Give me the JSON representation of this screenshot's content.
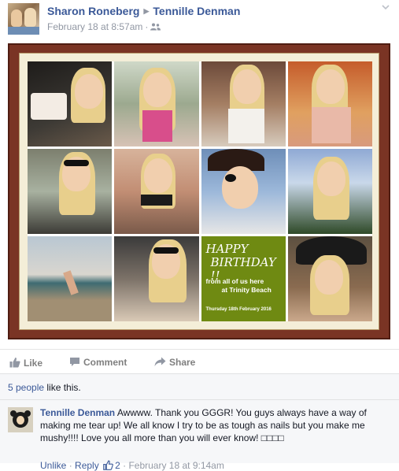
{
  "post": {
    "author": "Sharon Roneberg",
    "target": "Tennille Denman",
    "timestamp": "February 18 at 8:57am",
    "privacy_icon": "friends-icon",
    "menu_icon": "chevron-down-icon"
  },
  "photo": {
    "banner_line1": "HAPPY",
    "banner_line2": "BIRTHDAY !!",
    "banner_sub_line1": "from all of us here",
    "banner_sub_line2": "at Trinity Beach",
    "banner_date": "Thursday 18th February 2016",
    "colors": {
      "frame": "#7a3424",
      "mat": "#f4eed8",
      "banner": "#6f8a12"
    }
  },
  "actions": {
    "like": "Like",
    "comment": "Comment",
    "share": "Share"
  },
  "likes": {
    "count_link": "5 people",
    "suffix": " like this."
  },
  "comment": {
    "author": "Tennille Denman",
    "text": "Awwww. Thank you GGGR! You guys always have a way of making me tear up! We all know I try to be as tough as nails but you make me mushy!!!! Love you all more than you will ever know! □□□□",
    "unlike": "Unlike",
    "reply": "Reply",
    "like_count": "2",
    "timestamp": "February 18 at 9:14am",
    "separator": "·"
  },
  "theme": {
    "link": "#3b5998",
    "meta": "#9197a3",
    "action": "#7f7f7f",
    "feedback_bg": "#f6f7f9"
  }
}
